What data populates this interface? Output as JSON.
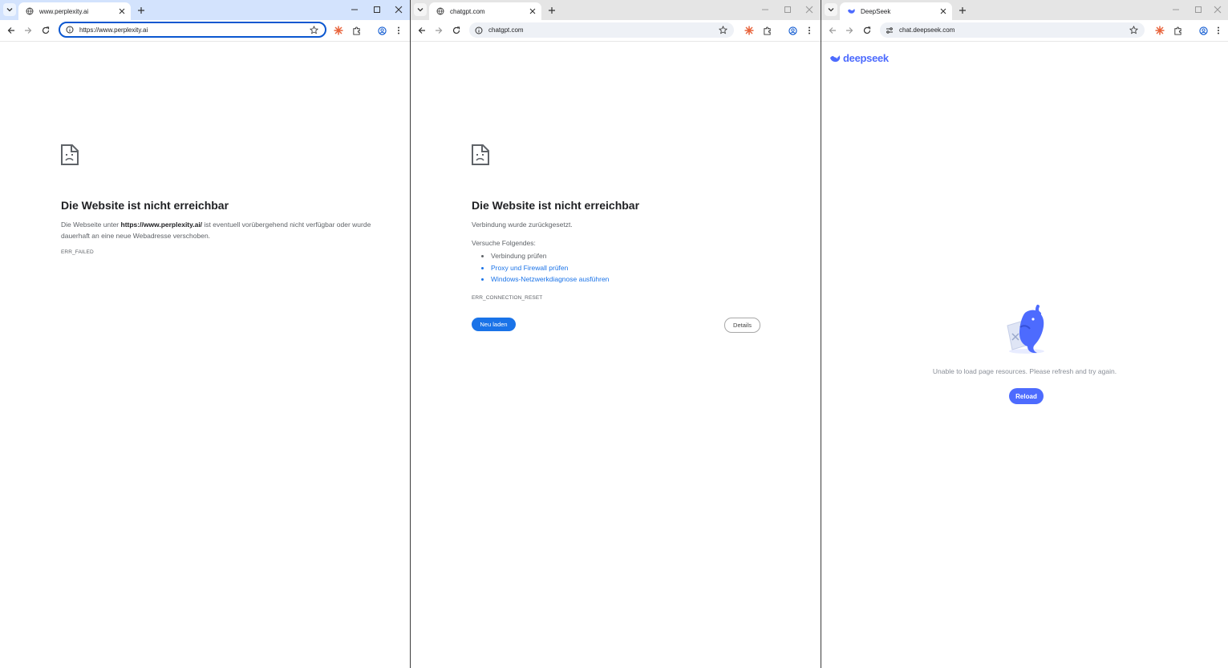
{
  "windows": [
    {
      "tab": {
        "title": "www.perplexity.ai",
        "favicon": "globe-icon"
      },
      "omnibox": {
        "url": "https://www.perplexity.ai",
        "focused": true
      },
      "page": {
        "heading": "Die Website ist nicht erreichbar",
        "text_prefix": "Die Webseite unter ",
        "text_bold": "https://www.perplexity.ai/",
        "text_suffix": " ist eventuell vorübergehend nicht verfügbar oder wurde dauerhaft an eine neue Webadresse verschoben.",
        "error_code": "ERR_FAILED"
      }
    },
    {
      "tab": {
        "title": "chatgpt.com",
        "favicon": "globe-icon"
      },
      "omnibox": {
        "url": "chatgpt.com",
        "focused": false
      },
      "page": {
        "heading": "Die Website ist nicht erreichbar",
        "text": "Verbindung wurde zurückgesetzt.",
        "try_label": "Versuche Folgendes:",
        "suggestions": [
          "Verbindung prüfen",
          "Proxy und Firewall prüfen",
          "Windows-Netzwerkdiagnose ausführen"
        ],
        "error_code": "ERR_CONNECTION_RESET",
        "reload_button": "Neu laden",
        "details_button": "Details"
      }
    },
    {
      "tab": {
        "title": "DeepSeek",
        "favicon": "deepseek-icon"
      },
      "omnibox": {
        "url": "chat.deepseek.com",
        "focused": false
      },
      "page": {
        "logo_text": "deepseek",
        "message": "Unable to load page resources. Please refresh and try again.",
        "reload_button": "Reload"
      }
    }
  ],
  "colors": {
    "accent": "#1a73e8",
    "deepseek": "#4d6bfe",
    "active_tabstrip": "#d3e3fd"
  }
}
